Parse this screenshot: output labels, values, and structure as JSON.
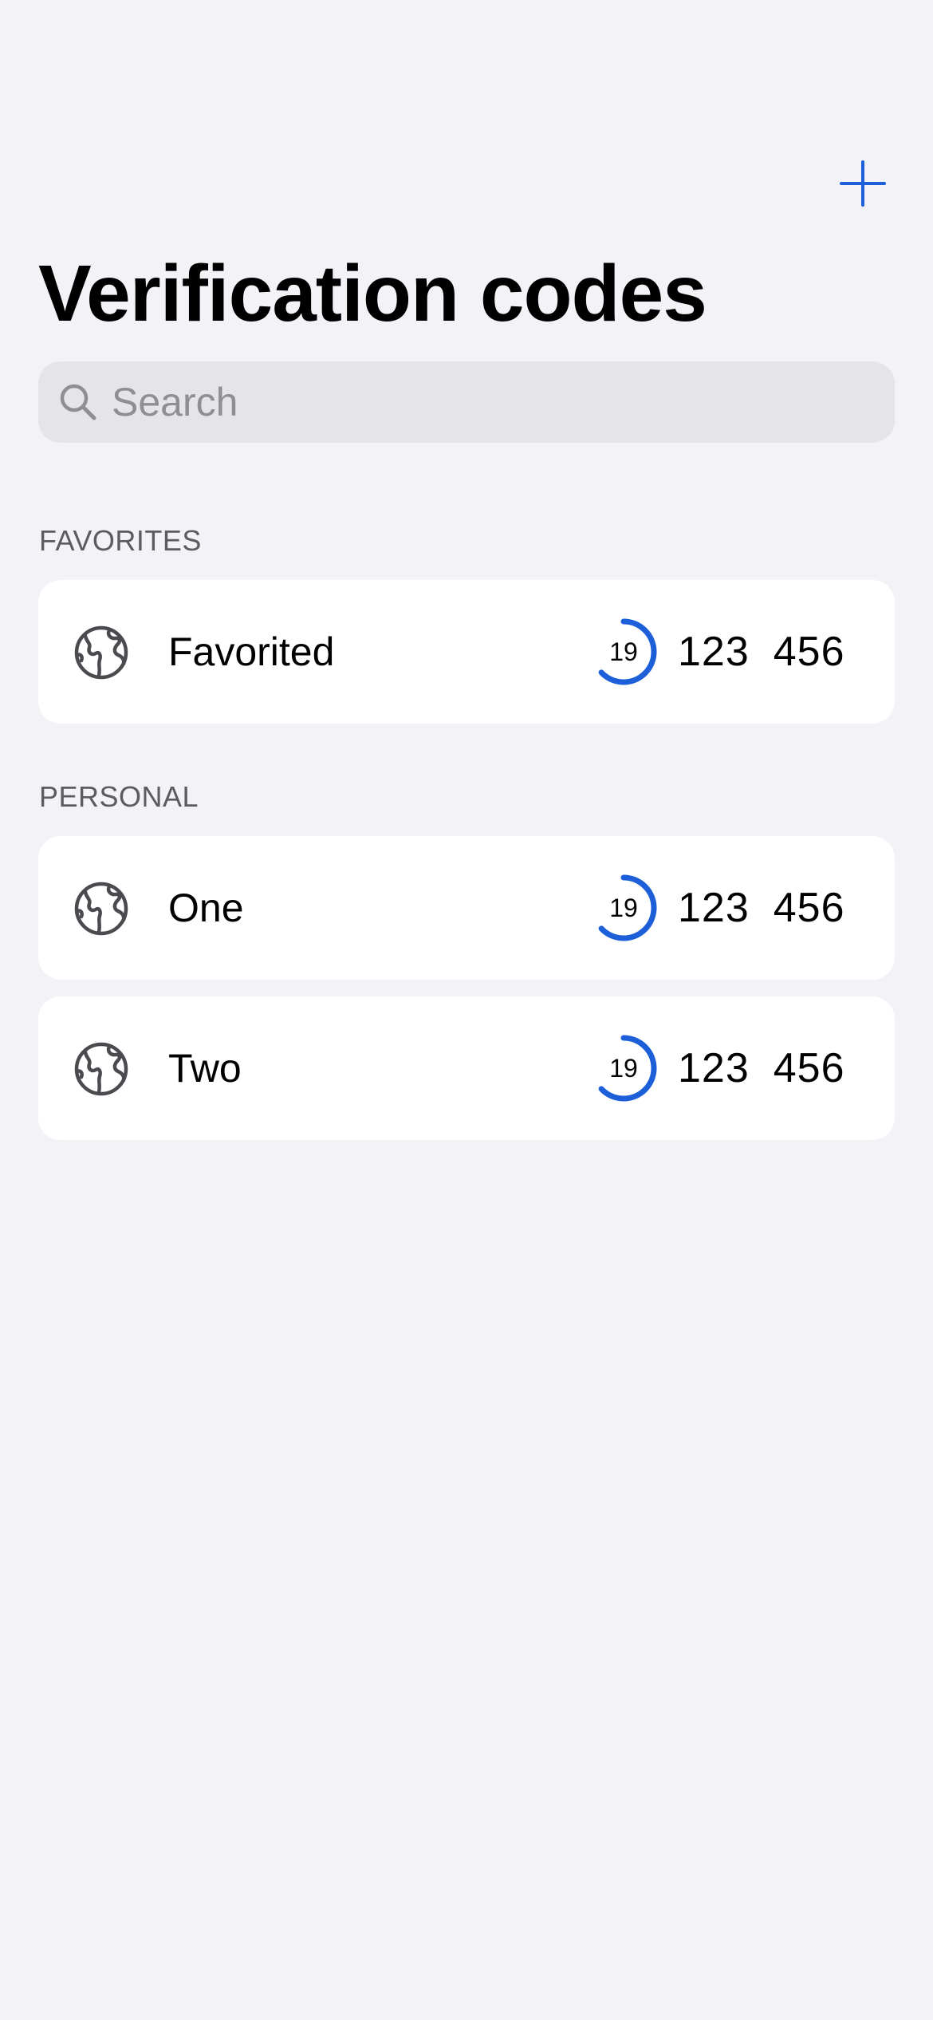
{
  "header": {
    "title": "Verification codes",
    "add_icon": "plus-icon"
  },
  "search": {
    "placeholder": "Search",
    "value": "",
    "icon": "magnifying-glass-icon"
  },
  "colors": {
    "accent": "#1C5FD9",
    "background": "#F2F2F7",
    "card": "#FFFFFF",
    "search_bg": "#E4E4E9",
    "secondary_text": "#5B5B60",
    "icon_gray": "#4A4A4F"
  },
  "timer_fraction_remaining": 0.63,
  "sections": [
    {
      "header": "FAVORITES",
      "items": [
        {
          "name": "Favorited",
          "icon": "globe-icon",
          "seconds": "19",
          "code_part1": "123",
          "code_part2": "456"
        }
      ]
    },
    {
      "header": "PERSONAL",
      "items": [
        {
          "name": "One",
          "icon": "globe-icon",
          "seconds": "19",
          "code_part1": "123",
          "code_part2": "456"
        },
        {
          "name": "Two",
          "icon": "globe-icon",
          "seconds": "19",
          "code_part1": "123",
          "code_part2": "456"
        }
      ]
    }
  ]
}
